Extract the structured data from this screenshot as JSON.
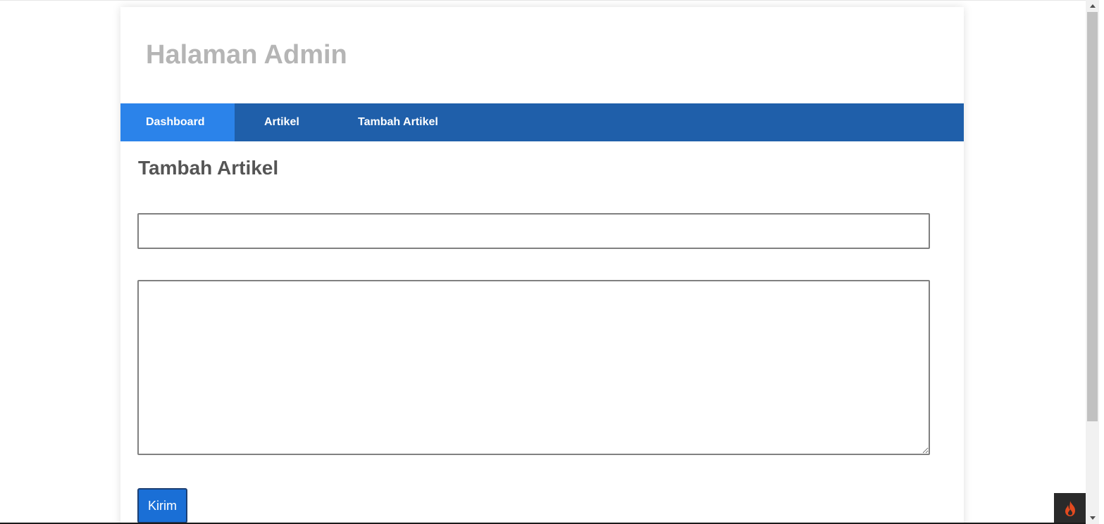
{
  "header": {
    "title": "Halaman Admin",
    "title_color": "#b5b5b5"
  },
  "nav": {
    "bar_color": "#1f5faa",
    "active_color": "#2b83ea",
    "items": [
      {
        "label": "Dashboard",
        "active": true
      },
      {
        "label": "Artikel",
        "active": false
      },
      {
        "label": "Tambah Artikel",
        "active": false
      }
    ]
  },
  "main": {
    "heading": "Tambah Artikel",
    "title_field": {
      "value": "",
      "placeholder": ""
    },
    "content_field": {
      "value": "",
      "placeholder": ""
    },
    "submit_label": "Kirim",
    "submit_color": "#1a6fd6"
  },
  "toolbar": {
    "icon": "codeigniter-flame-icon",
    "icon_color": "#e24a1f"
  }
}
